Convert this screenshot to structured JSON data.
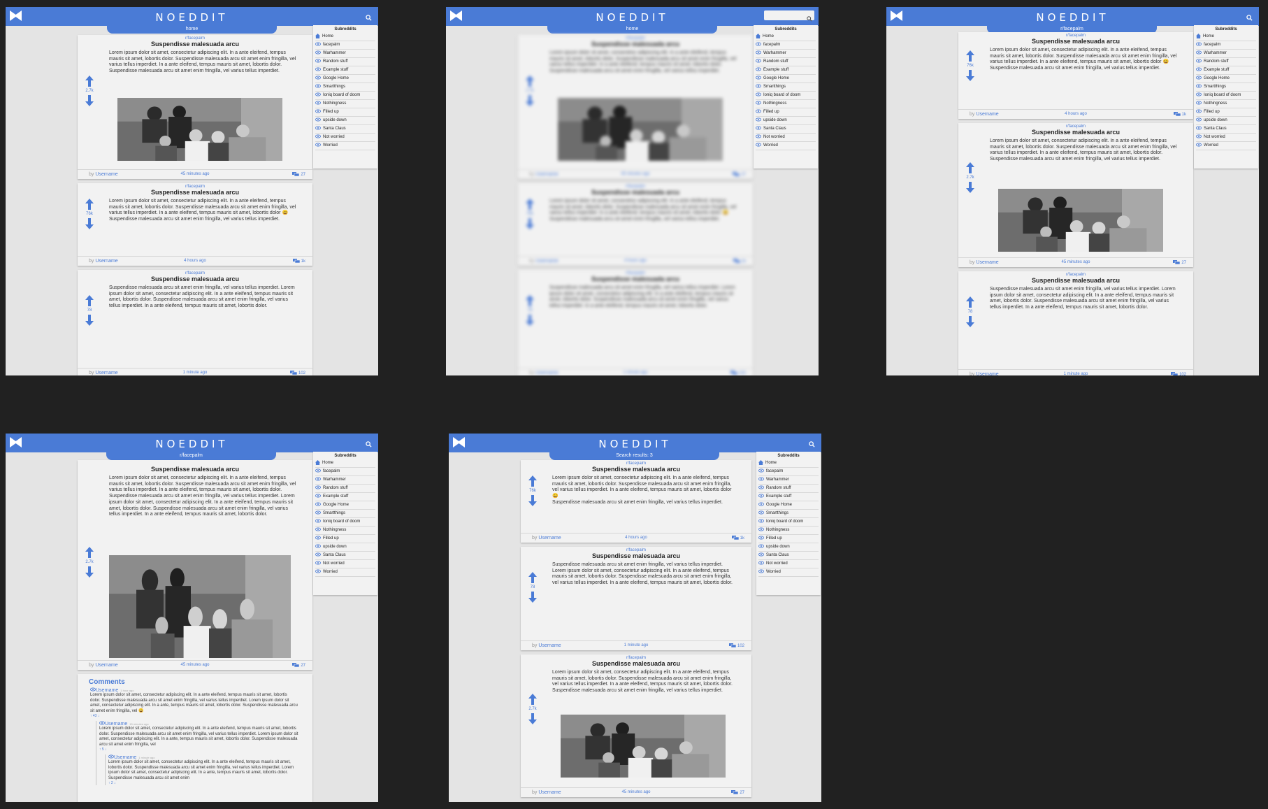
{
  "app": {
    "brand": "NOEDDIT"
  },
  "colors": {
    "accent": "#4a7bd6",
    "background": "#212121",
    "page": "#e4e4e4",
    "card": "#f2f2f2"
  },
  "lorem": {
    "p1": "Lorem ipsum dolor sit amet, consectetur adipiscing elit. In a ante eleifend, tempus mauris sit amet, lobortis dolor. Suspendisse malesuada arcu sit amet enim fringilla, vel varius tellus imperdiet.  In a ante eleifend, tempus mauris sit amet, lobortis dolor.",
    "p2": "Suspendisse malesuada arcu sit amet enim fringilla, vel varius tellus imperdiet.",
    "p2long": "Suspendisse malesuada arcu sit amet enim fringilla, vel varius tellus imperdiet. Lorem ipsum dolor sit amet, consectetur adipiscing elit. In a ante eleifend, tempus mauris sit amet, lobortis dolor. Suspendisse malesuada arcu sit amet enim fringilla, vel varius tellus imperdiet. In a ante eleifend, tempus mauris sit amet, lobortis dolor.",
    "p1emoji": "Lorem ipsum dolor sit amet, consectetur adipiscing elit. In a ante eleifend, tempus mauris sit amet, lobortis dolor. Suspendisse malesuada arcu sit amet enim fringilla, vel varius tellus imperdiet.  In a ante eleifend, tempus mauris sit amet, lobortis dolor 😀"
  },
  "post": {
    "subreddit": "r/facepalm",
    "title": "Suspendisse malesuada arcu",
    "by": "by",
    "username": "Username"
  },
  "posts_meta": {
    "a": {
      "votes": "2.7k",
      "time": "45 minutes ago",
      "comments": "27"
    },
    "b": {
      "votes": "76k",
      "time": "4 hours ago",
      "comments": "1k"
    },
    "c": {
      "votes": "78",
      "time": "1 minute ago",
      "comments": "102"
    }
  },
  "tabs": {
    "home": "home",
    "facepalm": "r/facepalm",
    "search": "Search results: 3"
  },
  "sidebar": {
    "title": "Subreddits",
    "items": [
      "Home",
      "facepalm",
      "Warhammer",
      "Random stuff",
      "Example stuff",
      "Google Home",
      "Smartthings",
      "Ioniq board of doom",
      "Nothingness",
      "Filled up",
      "upside down",
      "Santa Claus",
      "Not worried",
      "Worried"
    ]
  },
  "comments": {
    "title": "Comments",
    "c1": {
      "user": "Username",
      "time": "1 hour ago",
      "text": "Lorem ipsum dolor sit amet, consectetur adipiscing elit. In a ante eleifend, tempus mauris sit amet, lobortis dolor. Suspendisse malesuada arcu sit amet enim fringilla, vel varius tellus imperdiet. Lorem ipsum dolor sit amet, consectetur adipiscing elit. In a ante, tempus mauris sit amet, lobortis dolor. Suspendisse malesuada arcu sit amet enim fringilla, vel 😀",
      "votes": "43"
    },
    "c2": {
      "user": "Username",
      "time": "15 minutes ago",
      "text": "Lorem ipsum dolor sit amet, consectetur adipiscing elit. In a ante eleifend, tempus mauris sit amet, lobortis dolor. Suspendisse malesuada arcu sit amet enim fringilla, vel varius tellus imperdiet. Lorem ipsum dolor sit amet, consectetur adipiscing elit. In a ante, tempus mauris sit amet, lobortis dolor. Suspendisse malesuada arcu sit amet enim fringilla, vel",
      "votes": "5"
    },
    "c3": {
      "user": "Username",
      "time": "1 minute ago",
      "text": "Lorem ipsum dolor sit amet, consectetur adipiscing elit. In a ante eleifend, tempus mauris sit amet, lobortis dolor. Suspendisse malesuada arcu sit amet enim fringilla, vel varius tellus imperdiet. Lorem ipsum dolor sit amet, consectetur adipiscing elit. In a ante, tempus mauris sit amet, lobortis dolor. Suspendisse malesuada arcu sit amet enim",
      "votes": "2"
    }
  },
  "icons": {
    "logo": "bowtie-logo-icon",
    "search": "search-icon",
    "upvote": "arrow-up-icon",
    "downvote": "arrow-down-icon",
    "comments": "chat-bubbles-icon",
    "home": "home-icon",
    "subreddit": "eye-icon",
    "photo": "group-photo-image"
  }
}
